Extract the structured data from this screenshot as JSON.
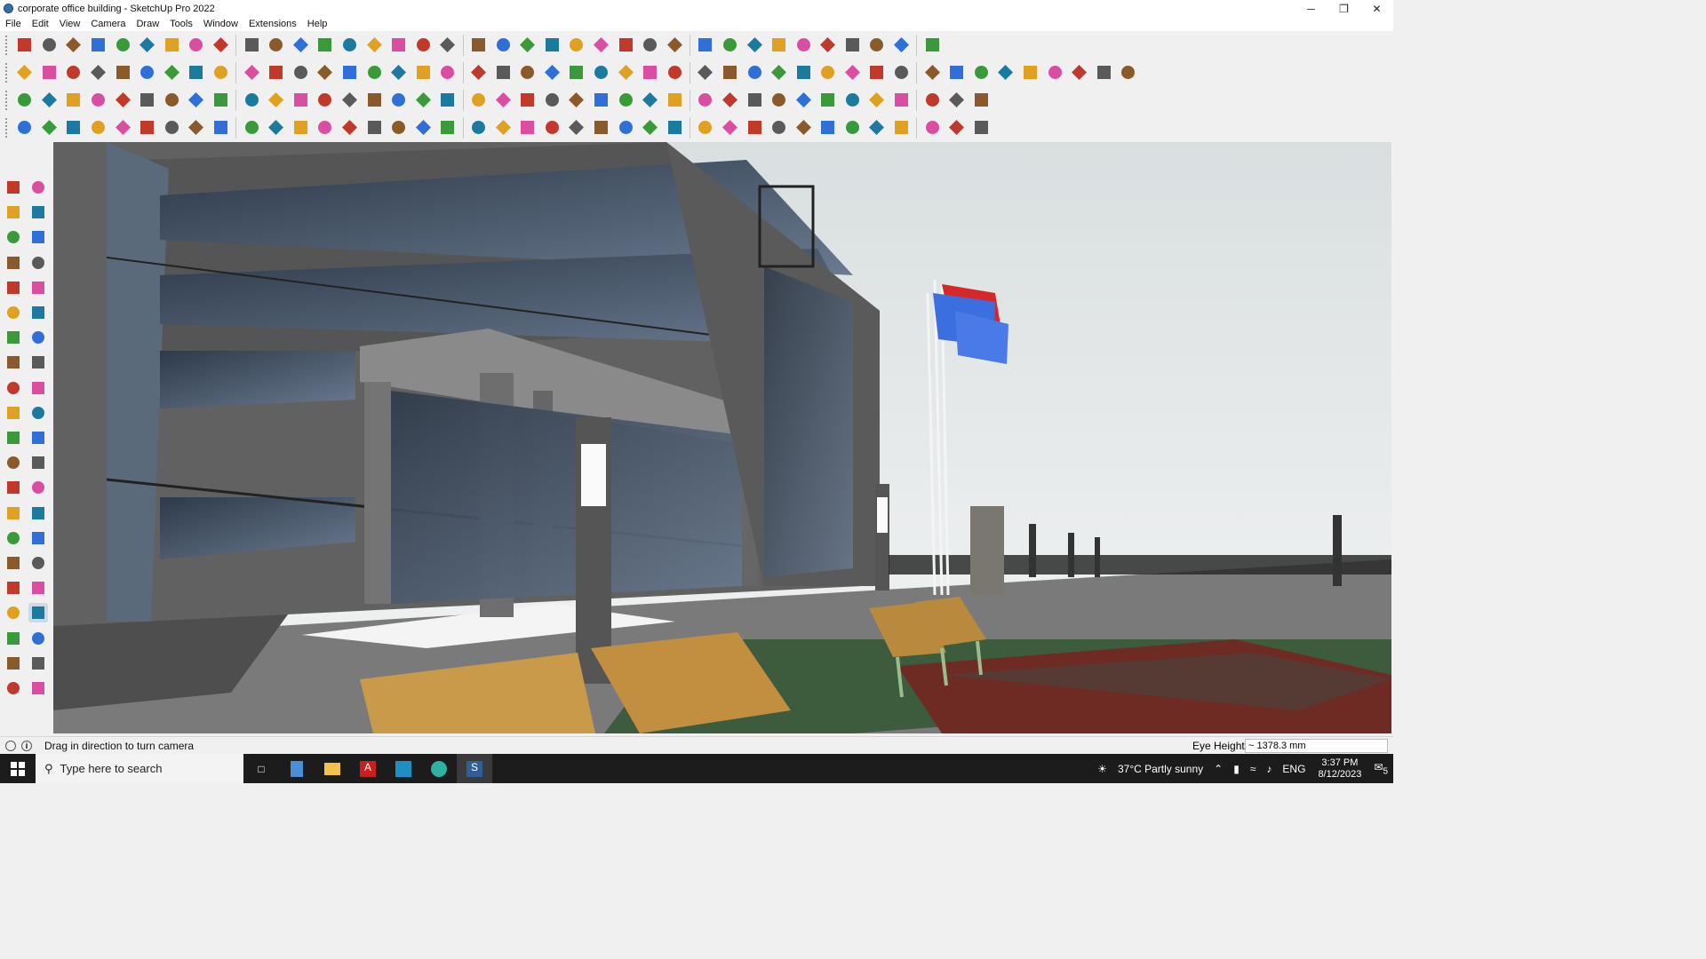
{
  "window": {
    "title": "corporate office building - SketchUp Pro 2022",
    "controls": {
      "minimize": "─",
      "restore": "❐",
      "close": "✕"
    }
  },
  "menu": [
    "File",
    "Edit",
    "View",
    "Camera",
    "Draw",
    "Tools",
    "Window",
    "Extensions",
    "Help"
  ],
  "toolbars": {
    "row1_count": 37,
    "row2_count": 45,
    "row3_count": 39,
    "row4_count": 39
  },
  "left_toolbar_icons": [
    "select-icon",
    "orbit-icon",
    "paint-bucket-icon",
    "eraser-icon",
    "tape-measure-icon",
    "pencil-icon",
    "line-icon",
    "freehand-icon",
    "rectangle-icon",
    "rotated-rectangle-icon",
    "circle-icon",
    "polygon-icon",
    "arc-icon",
    "pie-icon",
    "2-point-arc-icon",
    "3-point-arc-icon",
    "move-icon",
    "push-pull-icon",
    "rotate-icon",
    "follow-me-icon",
    "scale-icon",
    "offset-icon",
    "tape-icon",
    "text-icon",
    "protractor-icon",
    "3d-text-icon",
    "axes-icon",
    "dimension-icon",
    "orbit-tool-icon",
    "pan-icon",
    "zoom-icon",
    "zoom-window-icon",
    "zoom-extents-icon",
    "previous-view-icon",
    "position-camera-icon",
    "look-around-icon",
    "walk-icon",
    "section-plane-icon",
    "layers-icon",
    "hatch-icon",
    "stack-icon",
    "grid-icon"
  ],
  "status": {
    "message": "Drag in direction to turn camera",
    "measurement_label": "Eye Height",
    "measurement_value": "~ 1378.3 mm",
    "info_icon": "i"
  },
  "taskbar": {
    "search_placeholder": "Type here to search",
    "weather": "37°C  Partly sunny",
    "language": "ENG",
    "time": "3:37 PM",
    "date": "8/12/2023",
    "notification_count": "5",
    "app_label_a": "A",
    "app_label_s": "S"
  },
  "colors": {
    "accent": "#3a6ea5",
    "building": "#6b6b6b",
    "sky": "#e6eaea",
    "flag_red": "#d62828",
    "flag_blue": "#3b6fe0",
    "bench": "#c99a4a",
    "grass": "#3a5a3a"
  }
}
